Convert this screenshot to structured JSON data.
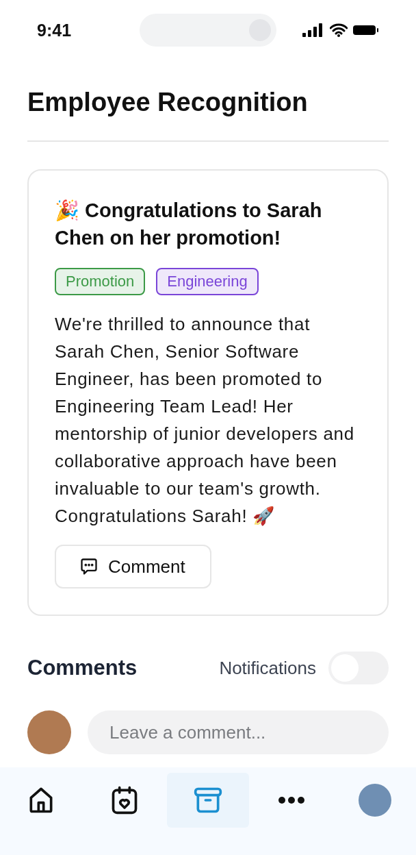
{
  "status_bar": {
    "time": "9:41"
  },
  "page": {
    "title": "Employee Recognition"
  },
  "post": {
    "title": "🎉 Congratulations to Sarah Chen on her promotion!",
    "tags": [
      {
        "label": "Promotion",
        "color": "#3c9a47"
      },
      {
        "label": "Engineering",
        "color": "#7a45d8"
      }
    ],
    "body": "We're thrilled to announce that Sarah Chen, Senior Software Engineer, has been promoted to Engineering Team Lead! Her mentorship of junior developers and collaborative approach have been invaluable to our team's growth. Congratulations Sarah! 🚀",
    "comment_button": "Comment"
  },
  "comments": {
    "title": "Comments",
    "notifications": {
      "label": "Notifications",
      "on": false
    },
    "input": {
      "placeholder": "Leave a comment..."
    }
  },
  "nav": [
    {
      "kind": "home",
      "selected": false
    },
    {
      "kind": "calendar",
      "selected": false
    },
    {
      "kind": "archive",
      "selected": true
    },
    {
      "kind": "more",
      "selected": false
    },
    {
      "kind": "avatar",
      "selected": false
    }
  ]
}
